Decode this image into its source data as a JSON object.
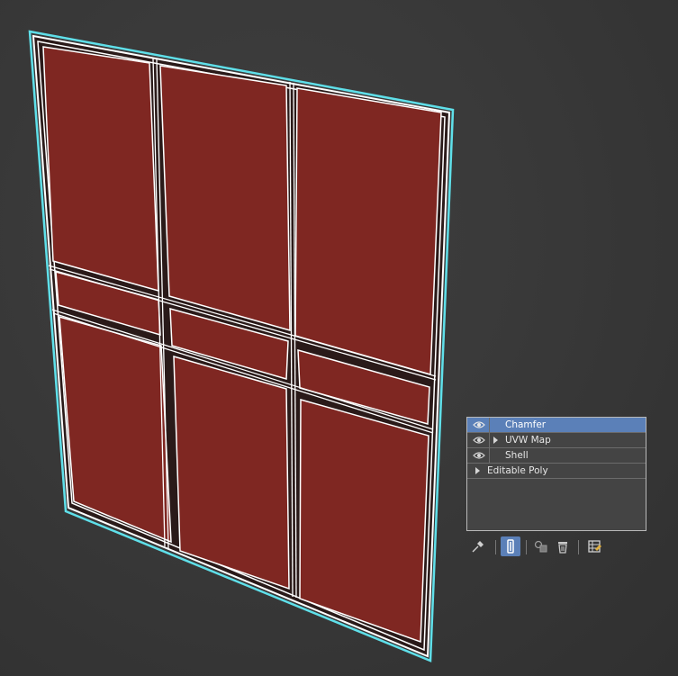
{
  "modifier_stack": {
    "items": [
      {
        "label": "Chamfer",
        "selected": true,
        "eye": true,
        "expandable": false
      },
      {
        "label": "UVW Map",
        "selected": false,
        "eye": true,
        "expandable": true
      },
      {
        "label": "Shell",
        "selected": false,
        "eye": true,
        "expandable": false
      },
      {
        "label": "Editable Poly",
        "selected": false,
        "eye": false,
        "expandable": true
      }
    ]
  },
  "toolbar": {
    "buttons": [
      {
        "icon": "pin-stack-icon",
        "active": false
      },
      {
        "icon": "show-end-result-icon",
        "active": true
      },
      {
        "icon": "make-unique-icon",
        "active": false
      },
      {
        "icon": "remove-modifier-icon",
        "active": false
      },
      {
        "icon": "configure-modifier-sets-icon",
        "active": false
      }
    ]
  },
  "colors": {
    "viewport_bg": "#393939",
    "panel_fill": "#7f2722",
    "frame_edge": "#ffffff",
    "selection_outline": "#5fe0ea",
    "selected_row": "#5b80b8"
  }
}
